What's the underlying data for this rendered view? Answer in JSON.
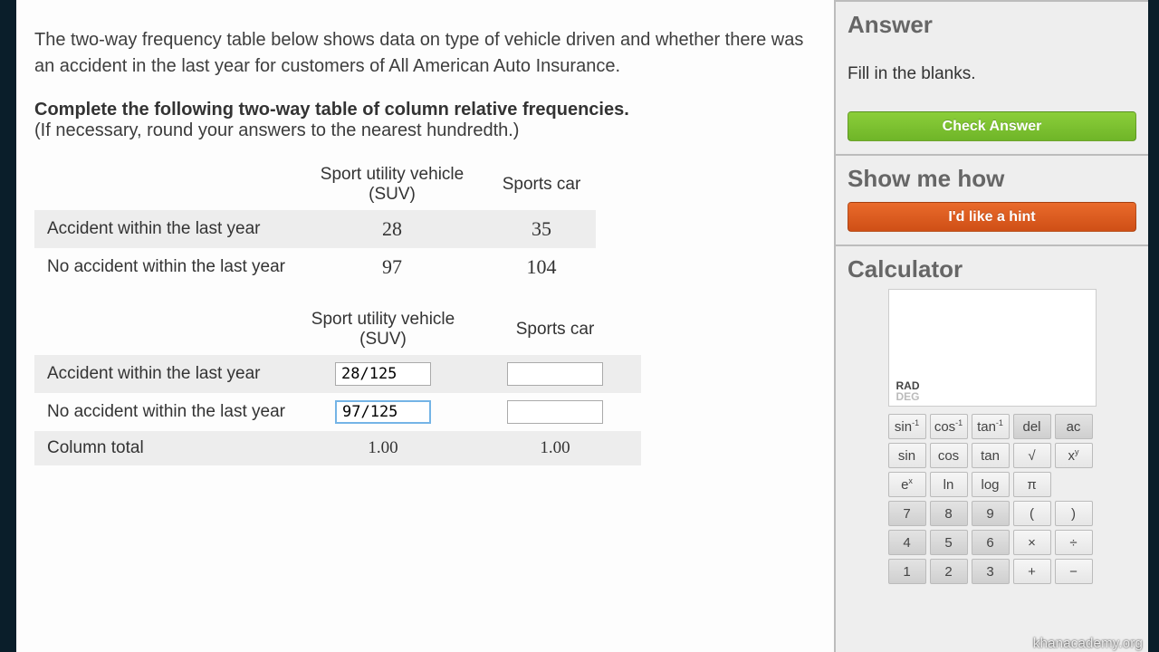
{
  "intro": "The two-way frequency table below shows data on type of vehicle driven and whether there was an accident in the last year for customers of All American Auto Insurance.",
  "instruction_bold": "Complete the following two-way table of column relative frequencies.",
  "instruction_note": "(If necessary, round your answers to the nearest hundredth.)",
  "table1": {
    "col1": "Sport utility vehicle (SUV)",
    "col2": "Sports car",
    "row1": {
      "label": "Accident within the last year",
      "v1": "28",
      "v2": "35"
    },
    "row2": {
      "label": "No accident within the last year",
      "v1": "97",
      "v2": "104"
    }
  },
  "table2": {
    "col1": "Sport utility vehicle (SUV)",
    "col2": "Sports car",
    "row1": {
      "label": "Accident within the last year",
      "v1": "28/125",
      "v2": ""
    },
    "row2": {
      "label": "No accident within the last year",
      "v1": "97/125",
      "v2": ""
    },
    "row3": {
      "label": "Column total",
      "v1": "1.00",
      "v2": "1.00"
    }
  },
  "sidebar": {
    "answer_title": "Answer",
    "answer_text": "Fill in the blanks.",
    "check_btn": "Check Answer",
    "hint_title": "Show me how",
    "hint_btn": "I'd like a hint",
    "calc_title": "Calculator",
    "mode_rad": "RAD",
    "mode_deg": "DEG"
  },
  "calc_buttons": [
    [
      "sin⁻¹",
      "cos⁻¹",
      "tan⁻¹",
      "del",
      "ac"
    ],
    [
      "sin",
      "cos",
      "tan",
      "√",
      "xʸ"
    ],
    [
      "eˣ",
      "ln",
      "log",
      "π",
      ""
    ],
    [
      "7",
      "8",
      "9",
      "(",
      ")"
    ],
    [
      "4",
      "5",
      "6",
      "×",
      "÷"
    ],
    [
      "1",
      "2",
      "3",
      "+",
      "−"
    ]
  ],
  "watermark": "khanacademy.org"
}
